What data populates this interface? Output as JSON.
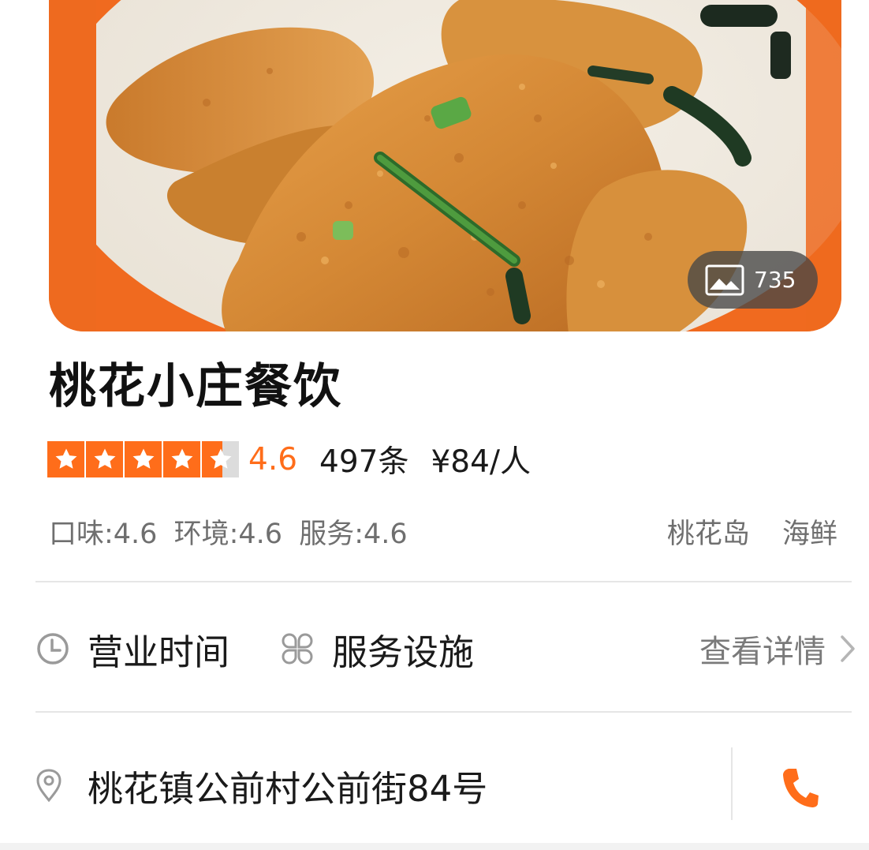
{
  "hero": {
    "photo_subject": "fried fish dish",
    "photo_count": "735",
    "icon": "image-icon"
  },
  "shop": {
    "name": "桃花小庄餐饮",
    "rating": 4.6,
    "rating_text": "4.6",
    "stars_out_of": 5,
    "reviews": "497条",
    "price": "¥84/人"
  },
  "sub_scores": {
    "taste": "口味:4.6",
    "environment": "环境:4.6",
    "service": "服务:4.6"
  },
  "tags": [
    "桃花岛",
    "海鲜"
  ],
  "info": {
    "hours_label": "营业时间",
    "hours_icon": "clock-icon",
    "facilities_label": "服务设施",
    "facilities_icon": "grid-icon",
    "detail_label": "查看详情",
    "detail_icon": "chevron-right-icon"
  },
  "address": {
    "text": "桃花镇公前村公前街84号",
    "icon": "location-pin-icon",
    "phone_icon": "phone-icon"
  },
  "colors": {
    "accent": "#ff6d1a",
    "muted_text": "#6f6f6f",
    "divider": "#e6e6e6"
  }
}
